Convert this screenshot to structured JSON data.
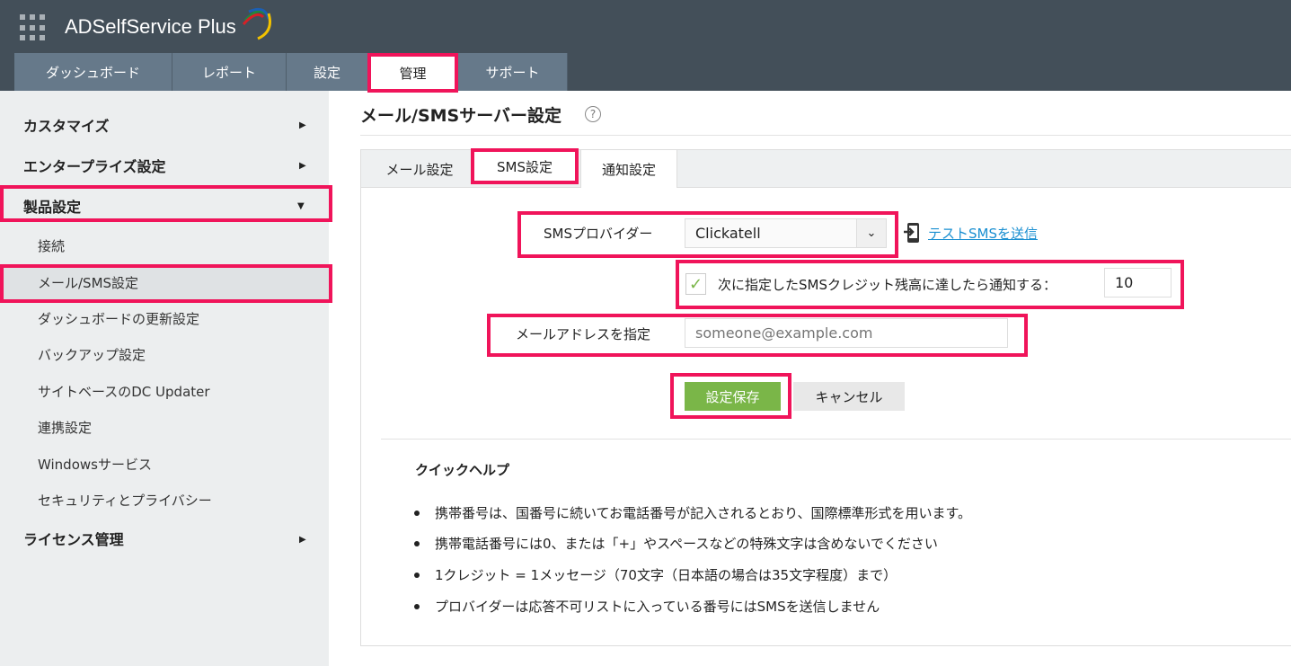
{
  "app": {
    "title": "ADSelfService Plus"
  },
  "nav": {
    "tabs": [
      "ダッシュボード",
      "レポート",
      "設定",
      "管理",
      "サポート"
    ],
    "active": "管理"
  },
  "sidebar": {
    "customize": "カスタマイズ",
    "enterprise": "エンタープライズ設定",
    "product": "製品設定",
    "items": [
      "接続",
      "メール/SMS設定",
      "ダッシュボードの更新設定",
      "バックアップ設定",
      "サイトベースのDC Updater",
      "連携設定",
      "Windowsサービス",
      "セキュリティとプライバシー"
    ],
    "license": "ライセンス管理"
  },
  "page": {
    "title": "メール/SMSサーバー設定",
    "help": "?"
  },
  "tabs": [
    "メール設定",
    "SMS設定",
    "通知設定"
  ],
  "form": {
    "provider_label": "SMSプロバイダー",
    "provider_value": "Clickatell",
    "test_link": "テストSMSを送信",
    "notify_label": "次に指定したSMSクレジット残高に達したら通知する：",
    "notify_checked": true,
    "notify_value": "10",
    "email_label": "メールアドレスを指定",
    "email_placeholder": "someone@example.com",
    "save": "設定保存",
    "cancel": "キャンセル"
  },
  "quickhelp": {
    "title": "クイックヘルプ",
    "items": [
      "携帯番号は、国番号に続いてお電話番号が記入されるとおり、国際標準形式を用います。",
      "携帯電話番号には0、または「+」やスペースなどの特殊文字は含めないでください",
      "1クレジット = 1メッセージ（70文字（日本語の場合は35文字程度）まで）",
      "プロバイダーは応答不可リストに入っている番号にはSMSを送信しません"
    ]
  },
  "colors": {
    "highlight": "#f0145a",
    "header": "#434f59",
    "nav": "#66798a",
    "save": "#7ab648",
    "link": "#1a8fd1"
  }
}
